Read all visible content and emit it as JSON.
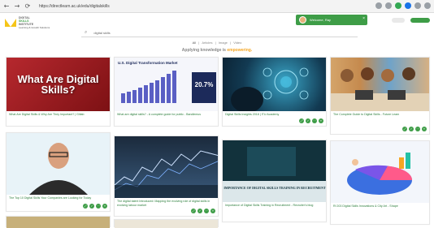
{
  "browser": {
    "url": "https://directlearn.ac.uk/edu/digitalskills",
    "back": "←",
    "forward": "→",
    "reload": "⟳"
  },
  "site": {
    "logo_lines": [
      "DIGITAL",
      "SKILLS",
      "INSTITUTE",
      "Learning & Growth Solutions"
    ]
  },
  "profile": {
    "name": "Welcome, Ray",
    "close": "×"
  },
  "search": {
    "placeholder": "digital skills"
  },
  "filters": {
    "items": [
      "All",
      "Articles",
      "Image",
      "Video"
    ],
    "separator": "|"
  },
  "tagline": {
    "text": "Applying knowledge is",
    "highlight": "empowering."
  },
  "cards": [
    {
      "caption": "What Are Digital Skills & Why Are They Important? | Gitlab",
      "thumb_text": "What Are Digital Skills?"
    },
    {
      "caption": "What are digital skills? - A complete guide for public - Bandlemus",
      "thumb_title": "U.S. Digital Transformation Market",
      "thumb_stat": "20.7%"
    },
    {
      "caption": "Digital Skills Insights 2018 | ITU Academy"
    },
    {
      "caption": "The Complete Guide to Digital Skills - Future Learn"
    },
    {
      "caption": "The Top 10 Digital Skills Your Companies are Looking for Today"
    },
    {
      "caption": "The digital talent Introduced: Mapping the evolving role of digital skills in evolving labour market"
    },
    {
      "caption": "Importance of Digital Skills Training in Recruitment - Recruiter's blog",
      "thumb_text": "IMPORTANCE OF DIGITAL SKILLS TRAINING IN RECRUITMENT"
    },
    {
      "caption": "Rl 203 Digital Skills Innovations & City Art - Shape"
    }
  ],
  "actions": [
    "⤢",
    "✓",
    "⋯",
    "+"
  ]
}
